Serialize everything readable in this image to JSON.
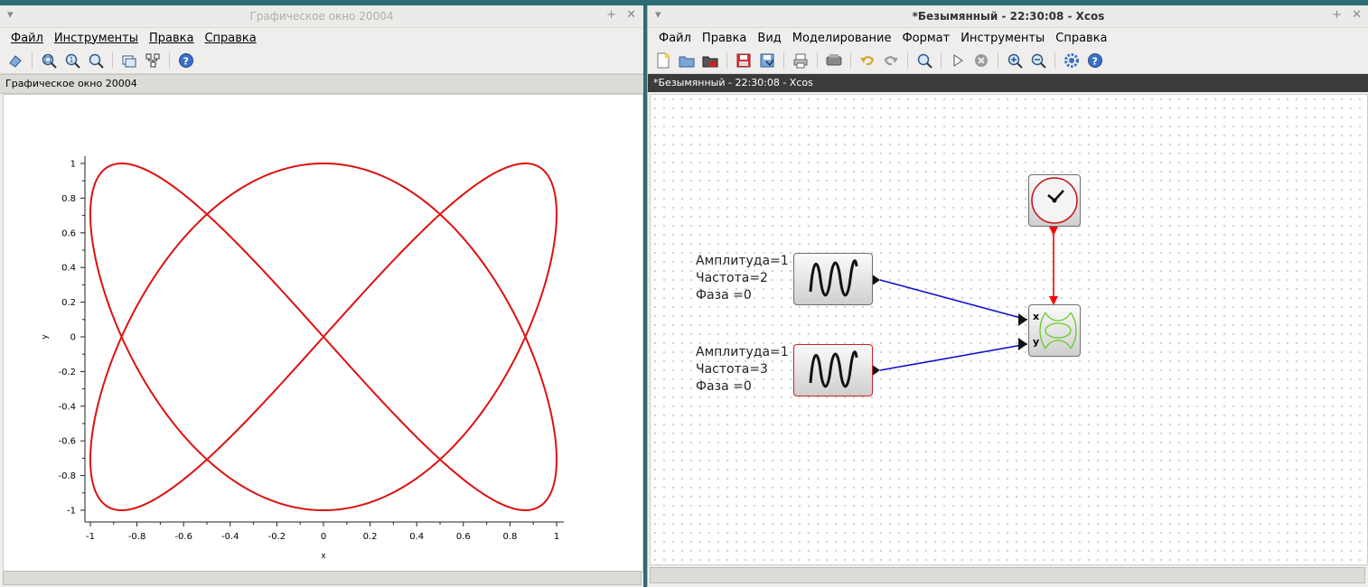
{
  "graphic_window": {
    "title": "Графическое окно 20004",
    "menu": [
      "Файл",
      "Инструменты",
      "Правка",
      "Справка"
    ],
    "toolbar_icons": [
      "rotate-icon",
      "zoom-area-icon",
      "zoom-reset-icon",
      "zoom-icon",
      "datatip-icon",
      "figure-editor-icon",
      "help-icon"
    ],
    "figure_label": "Графическое окно 20004"
  },
  "chart_data": {
    "type": "line",
    "title": "",
    "xlabel": "x",
    "ylabel": "y",
    "xlim": [
      -1,
      1
    ],
    "ylim": [
      -1,
      1
    ],
    "x_ticks": [
      "-1",
      "-0.8",
      "-0.6",
      "-0.4",
      "-0.2",
      "0",
      "0.2",
      "0.4",
      "0.6",
      "0.8",
      "1"
    ],
    "y_ticks": [
      "1",
      "0.8",
      "0.6",
      "0.4",
      "0.2",
      "0",
      "-0.2",
      "-0.4",
      "-0.6",
      "-0.8",
      "-1"
    ],
    "series": [
      {
        "color": "#dd1111",
        "x_function": "sin(2t)",
        "y_function": "sin(3t)",
        "sample_points": [
          {
            "x": 0,
            "y": 0
          },
          {
            "x": 1,
            "y": 0.707
          },
          {
            "x": 0,
            "y": -1
          },
          {
            "x": -1,
            "y": 0.707
          },
          {
            "x": 0,
            "y": 0
          },
          {
            "x": 1,
            "y": -0.707
          },
          {
            "x": 0,
            "y": 1
          },
          {
            "x": -1,
            "y": -0.707
          }
        ]
      }
    ],
    "grid": false
  },
  "xcos_window": {
    "title": "*Безымянный - 22:30:08 - Xcos",
    "menu": [
      "Файл",
      "Правка",
      "Вид",
      "Моделирование",
      "Формат",
      "Инструменты",
      "Справка"
    ],
    "toolbar_icons": [
      "new-icon",
      "open-icon",
      "open-folder-icon",
      "save-icon",
      "save-as-icon",
      "print-icon",
      "export-icon",
      "undo-icon",
      "redo-icon",
      "fit-diagram-icon",
      "start-icon",
      "stop-icon",
      "zoom-in-icon",
      "zoom-out-icon",
      "setup-icon",
      "help-icon"
    ],
    "tab_label": "*Безымянный - 22:30:08 - Xcos",
    "generators": [
      {
        "lines": [
          "Амплитуда=1",
          "Частота=2",
          "Фаза =0"
        ],
        "selected": false
      },
      {
        "lines": [
          "Амплитуда=1",
          "Частота=3",
          "Фаза =0"
        ],
        "selected": true
      }
    ],
    "scope_ports": [
      "x",
      "y"
    ],
    "colors": {
      "data_link": "#1010cc",
      "event_link": "#ff0000",
      "scope_curve": "#66cc22"
    }
  }
}
